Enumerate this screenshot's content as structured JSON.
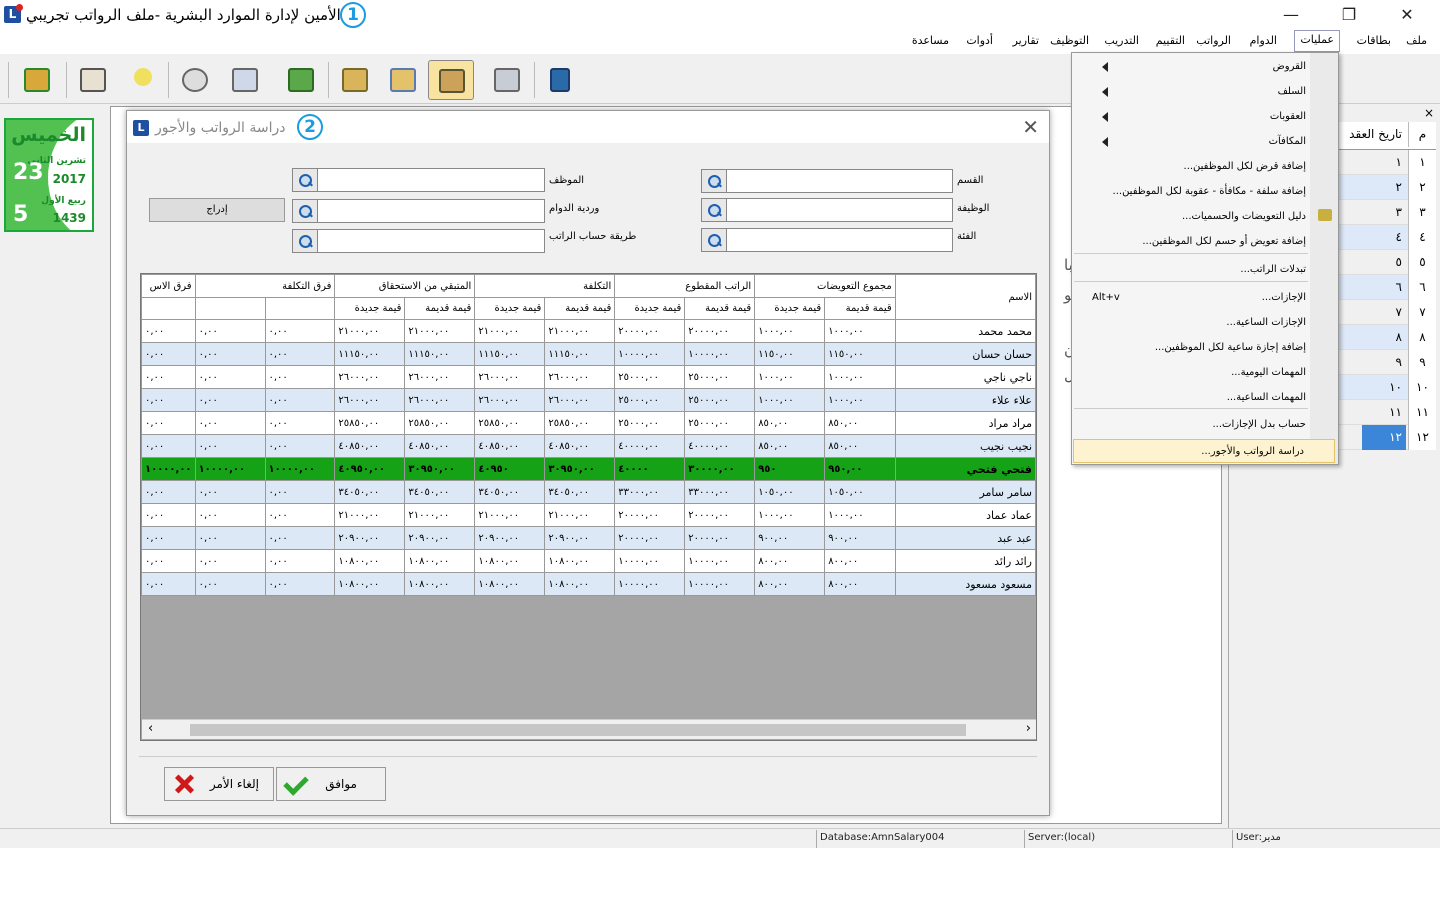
{
  "app": {
    "title": "الأمين لإدارة الموارد البشرية -ملف الرواتب تجريبي",
    "callout1": "1",
    "callout2": "2"
  },
  "menubar": [
    "ملف",
    "بطاقات",
    "عمليات",
    "الدوام",
    "الرواتب",
    "التقييم",
    "التدريب",
    "التوظيف",
    "تقارير",
    "أدوات",
    "مساعدة"
  ],
  "menu_active": "عمليات",
  "calendar": {
    "day_name": "الخميس",
    "greg_month": "تشرين الثاني",
    "greg_year": "2017",
    "greg_day": "23",
    "hijri_month": "ربيع الأول",
    "hijri_year": "1439",
    "hijri_day": "5"
  },
  "operations_menu": [
    {
      "label": "القروض",
      "submenu": true
    },
    {
      "label": "السلف",
      "submenu": true
    },
    {
      "label": "العقوبات",
      "submenu": true
    },
    {
      "label": "المكافآت",
      "submenu": true
    },
    {
      "label": "إضافة قرض لكل الموظفين..."
    },
    {
      "label": "إضافة سلفة - مكافأة - عقوبة لكل الموظفين..."
    },
    {
      "label": "دليل التعويضات والحسميات..."
    },
    {
      "label": "إضافة تعويض أو حسم لكل الموظفين..."
    },
    {
      "label": "تبدلات الراتب..."
    },
    {
      "label": "الإجازات...",
      "shortcut": "Alt+v"
    },
    {
      "label": "الإجازات الساعية..."
    },
    {
      "label": "إضافة إجازة ساعية لكل الموظفين..."
    },
    {
      "label": "المهمات اليومية..."
    },
    {
      "label": "المهمات الساعية..."
    },
    {
      "label": "حساب بدل الإجازات..."
    },
    {
      "label": "دراسة الرواتب والأجور..."
    }
  ],
  "right_panel": {
    "col_num": "م",
    "col_date": "تاريخ العقد",
    "close": "×",
    "rows": [
      "١",
      "٢",
      "٣",
      "٤",
      "٥",
      "٦",
      "٧",
      "٨",
      "٩",
      "١٠",
      "١١",
      "١٢"
    ]
  },
  "bg_text": [
    "ن با",
    "ن تو",
    "ون",
    "ت ل"
  ],
  "dialog": {
    "title": "دراسة الرواتب والأجور",
    "labels": {
      "department": "القسم",
      "employee": "الموظف",
      "job": "الوظيفة",
      "shift": "وردية الدوام",
      "category": "الفئة",
      "calc_method": "طريقة حساب الراتب"
    },
    "insert_button": "إدراج",
    "ok_button": "موافق",
    "cancel_button": "إلغاء الأمر"
  },
  "grid": {
    "group_headers": [
      "الاسم",
      "مجموع التعويضات",
      "الراتب المقطوع",
      "التكلفة",
      "المتبقي من الاستحقاق",
      "فرق التكلفة",
      "فرق الاس"
    ],
    "sub_headers": [
      "قيمة قديمة",
      "قيمة جديدة"
    ],
    "rows": [
      {
        "name": "محمد محمد",
        "v": [
          "١٠٠٠,٠٠",
          "١٠٠٠,٠٠",
          "٢٠٠٠٠,٠٠",
          "٢٠٠٠٠,٠٠",
          "٢١٠٠٠,٠٠",
          "٢١٠٠٠,٠٠",
          "٢١٠٠٠,٠٠",
          "٢١٠٠٠,٠٠",
          "٠,٠٠",
          "٠,٠٠"
        ]
      },
      {
        "name": "حسان حسان",
        "v": [
          "١١٥٠,٠٠",
          "١١٥٠,٠٠",
          "١٠٠٠٠,٠٠",
          "١٠٠٠٠,٠٠",
          "١١١٥٠,٠٠",
          "١١١٥٠,٠٠",
          "١١١٥٠,٠٠",
          "١١١٥٠,٠٠",
          "٠,٠٠",
          "٠,٠٠"
        ]
      },
      {
        "name": "ناجي ناجي",
        "v": [
          "١٠٠٠,٠٠",
          "١٠٠٠,٠٠",
          "٢٥٠٠٠,٠٠",
          "٢٥٠٠٠,٠٠",
          "٢٦٠٠٠,٠٠",
          "٢٦٠٠٠,٠٠",
          "٢٦٠٠٠,٠٠",
          "٢٦٠٠٠,٠٠",
          "٠,٠٠",
          "٠,٠٠"
        ]
      },
      {
        "name": "علاء علاء",
        "v": [
          "١٠٠٠,٠٠",
          "١٠٠٠,٠٠",
          "٢٥٠٠٠,٠٠",
          "٢٥٠٠٠,٠٠",
          "٢٦٠٠٠,٠٠",
          "٢٦٠٠٠,٠٠",
          "٢٦٠٠٠,٠٠",
          "٢٦٠٠٠,٠٠",
          "٠,٠٠",
          "٠,٠٠"
        ]
      },
      {
        "name": "مراد مراد",
        "v": [
          "٨٥٠,٠٠",
          "٨٥٠,٠٠",
          "٢٥٠٠٠,٠٠",
          "٢٥٠٠٠,٠٠",
          "٢٥٨٥٠,٠٠",
          "٢٥٨٥٠,٠٠",
          "٢٥٨٥٠,٠٠",
          "٢٥٨٥٠,٠٠",
          "٠,٠٠",
          "٠,٠٠"
        ]
      },
      {
        "name": "نجيب نجيب",
        "v": [
          "٨٥٠,٠٠",
          "٨٥٠,٠٠",
          "٤٠٠٠٠,٠٠",
          "٤٠٠٠٠,٠٠",
          "٤٠٨٥٠,٠٠",
          "٤٠٨٥٠,٠٠",
          "٤٠٨٥٠,٠٠",
          "٤٠٨٥٠,٠٠",
          "٠,٠٠",
          "٠,٠٠"
        ]
      },
      {
        "name": "فتحي فتحي",
        "v": [
          "٩٥٠,٠٠",
          "٩٥٠",
          "٣٠٠٠٠,٠٠",
          "٤٠٠٠٠",
          "٣٠٩٥٠,٠٠",
          "٤٠٩٥٠",
          "٣٠٩٥٠,٠٠",
          "٤٠٩٥٠,٠٠",
          "١٠٠٠٠,٠٠",
          "١٠٠٠٠,٠٠"
        ],
        "highlight": true
      },
      {
        "name": "سامر سامر",
        "v": [
          "١٠٥٠,٠٠",
          "١٠٥٠,٠٠",
          "٣٣٠٠٠,٠٠",
          "٣٣٠٠٠,٠٠",
          "٣٤٠٥٠,٠٠",
          "٣٤٠٥٠,٠٠",
          "٣٤٠٥٠,٠٠",
          "٣٤٠٥٠,٠٠",
          "٠,٠٠",
          "٠,٠٠"
        ]
      },
      {
        "name": "عماد عماد",
        "v": [
          "١٠٠٠,٠٠",
          "١٠٠٠,٠٠",
          "٢٠٠٠٠,٠٠",
          "٢٠٠٠٠,٠٠",
          "٢١٠٠٠,٠٠",
          "٢١٠٠٠,٠٠",
          "٢١٠٠٠,٠٠",
          "٢١٠٠٠,٠٠",
          "٠,٠٠",
          "٠,٠٠"
        ]
      },
      {
        "name": "عبد عبد",
        "v": [
          "٩٠٠,٠٠",
          "٩٠٠,٠٠",
          "٢٠٠٠٠,٠٠",
          "٢٠٠٠٠,٠٠",
          "٢٠٩٠٠,٠٠",
          "٢٠٩٠٠,٠٠",
          "٢٠٩٠٠,٠٠",
          "٢٠٩٠٠,٠٠",
          "٠,٠٠",
          "٠,٠٠"
        ]
      },
      {
        "name": "رائد رائد",
        "v": [
          "٨٠٠,٠٠",
          "٨٠٠,٠٠",
          "١٠٠٠٠,٠٠",
          "١٠٠٠٠,٠٠",
          "١٠٨٠٠,٠٠",
          "١٠٨٠٠,٠٠",
          "١٠٨٠٠,٠٠",
          "١٠٨٠٠,٠٠",
          "٠,٠٠",
          "٠,٠٠"
        ]
      },
      {
        "name": "مسعود مسعود",
        "v": [
          "٨٠٠,٠٠",
          "٨٠٠,٠٠",
          "١٠٠٠٠,٠٠",
          "١٠٠٠٠,٠٠",
          "١٠٨٠٠,٠٠",
          "١٠٨٠٠,٠٠",
          "١٠٨٠٠,٠٠",
          "١٠٨٠٠,٠٠",
          "٠,٠٠",
          "٠,٠٠"
        ]
      }
    ]
  },
  "statusbar": {
    "database": "Database:AmnSalary004",
    "server": "Server:(local)",
    "user": "User:مدير"
  },
  "colors": {
    "highlight_row": "#16a216",
    "alt_row": "#dce8f6",
    "menu_highlight": "#fdf3d0",
    "callout": "#1b9be0"
  }
}
